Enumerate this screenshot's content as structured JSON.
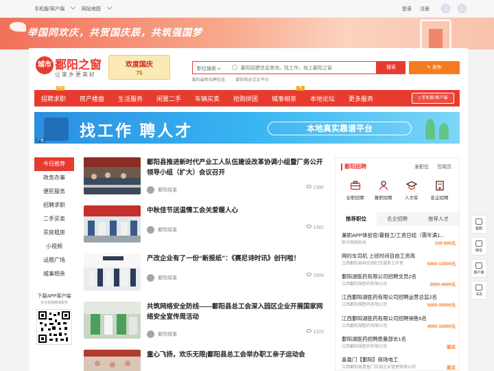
{
  "topbar": {
    "mobile_link": "手机版/客户端",
    "sitemap_link": "网站地图",
    "login": "登录",
    "register": "注册"
  },
  "banner": {
    "slogan": "举国同欢庆，共贺国庆辰，共筑强国梦"
  },
  "logo": {
    "badge": "城市",
    "title": "鄱阳之窗",
    "subtitle": "让家乡更美好"
  },
  "holiday_badge": {
    "title": "欢度国庆",
    "sub": "75"
  },
  "search": {
    "category": "职位搜索",
    "placeholder": "鄱阳招聘信息查询，找工作，就上鄱阳之窗",
    "button": "搜索",
    "publish": "发布",
    "hot_links": [
      "鄱阳最新招聘信息",
      "鄱阳相亲交友平台"
    ]
  },
  "nav": {
    "items": [
      "招聘求职",
      "房产楼盘",
      "生活服务",
      "闲置二手",
      "车辆买卖",
      "抢购拼团",
      "城事相亲",
      "本地论坛",
      "更多服务"
    ],
    "tags": [
      "热招",
      "热"
    ],
    "mobile_button": "手机版/客户端"
  },
  "ad": {
    "main": "找工作 聘人才",
    "pill": "本地真实靠谱平台",
    "tag": "广告"
  },
  "sidebar": {
    "items": [
      "今日推荐",
      "政务办事",
      "便民服务",
      "招聘求职",
      "二手买卖",
      "买房租房",
      "小视频",
      "话题广场",
      "城事相亲"
    ],
    "app_title": "下载APP客户端",
    "app_sub": "安全便捷精准服务"
  },
  "news": [
    {
      "title": "鄱阳县推进新时代产业工人队伍建设改革协调小组暨厂务公开领导小组（扩大）会议召开",
      "author": "鄱阳城事",
      "views": "2390"
    },
    {
      "title": "中秋佳节送温情工会关爱暖人心",
      "author": "鄱阳城事",
      "views": "1341"
    },
    {
      "title": "产改企业有了一份“新报纸”：《赛尼诗时讯》创刊啦！",
      "author": "鄱阳城事",
      "views": "3304"
    },
    {
      "title": "共筑网络安全防线——鄱阳县总工会深入园区企业开展国家网络安全宣传周活动",
      "author": "鄱阳城事",
      "views": "1315"
    },
    {
      "title": "童心飞扬，欢乐无限|鄱阳县总工会举办职工亲子运动会",
      "author": "",
      "views": ""
    }
  ],
  "jobs_panel": {
    "title": "鄱阳招聘",
    "post_job": "发职位",
    "post_resume": "写简历",
    "icons": [
      {
        "label": "全职招聘",
        "icon": "briefcase-icon"
      },
      {
        "label": "兼职招聘",
        "icon": "person-icon"
      },
      {
        "label": "人才库",
        "icon": "graduation-cap-icon"
      },
      {
        "label": "名企招聘",
        "icon": "building-icon"
      }
    ],
    "tabs": [
      "推荐职位",
      "名企招聘",
      "推荐人才"
    ],
    "jobs": [
      {
        "name": "兼职APP体验官/暑假工/工资日结（需年满1...",
        "company": "椋子网络科技",
        "salary": "150-500元"
      },
      {
        "name": "网约车司机 上班时间自由工资高",
        "company": "江西鄱阳县林氏网约车服务工作室",
        "salary": "5000-12000元"
      },
      {
        "name": "鄱阳湖医药有限公司招聘文员2名",
        "company": "江西鄱阳湖医药有限公司",
        "salary": "3000-4000元"
      },
      {
        "name": "江西鄱阳湖医药有限公司招聘运营总监2名",
        "company": "江西鄱阳湖医药有限公司",
        "salary": "5000-10000元"
      },
      {
        "name": "江西鄱阳湖医药有限公司招聘销售6名",
        "company": "江西鄱阳湖医药有限公司",
        "salary": "4000-10000元"
      },
      {
        "name": "鄱阳湖医药招聘质量部长1名",
        "company": "江西鄱阳湖医药有限公司",
        "salary": "面议"
      },
      {
        "name": "喜盈门【鄱阳】商场电工",
        "company": "江西鄱阳县喜盈门百城企业管理有限公司",
        "salary": "面议"
      }
    ]
  },
  "float_bar": [
    "客服",
    "微信",
    "客户端",
    "书页"
  ],
  "colors": {
    "brand_red": "#e83b2f",
    "orange": "#f57b21"
  }
}
